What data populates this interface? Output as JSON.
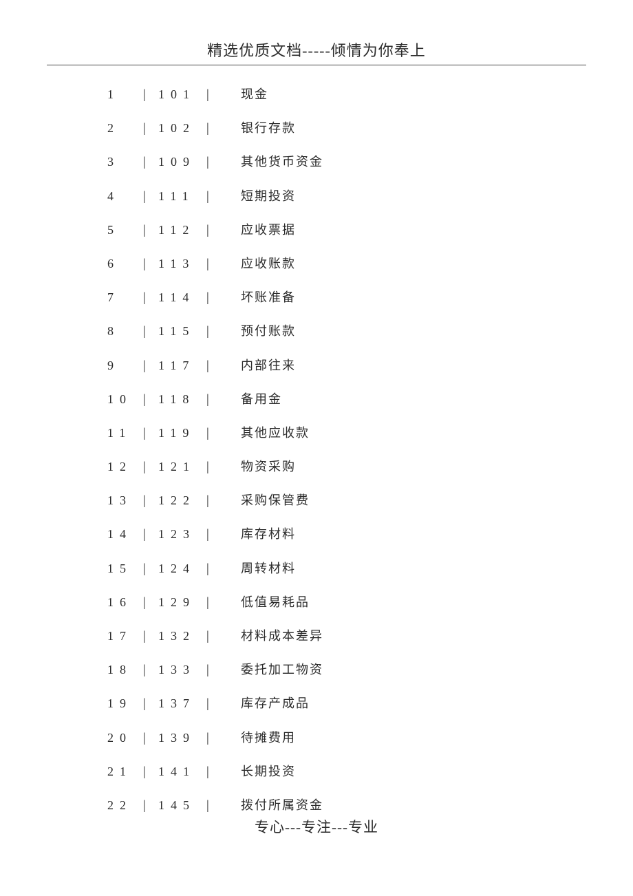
{
  "header": "精选优质文档-----倾情为你奉上",
  "footer": "专心---专注---专业",
  "sep": "|",
  "rows": [
    {
      "seq": "1",
      "code": "101",
      "name": "现金"
    },
    {
      "seq": "2",
      "code": "102",
      "name": "银行存款"
    },
    {
      "seq": "3",
      "code": "109",
      "name": "其他货币资金"
    },
    {
      "seq": "4",
      "code": "111",
      "name": "短期投资"
    },
    {
      "seq": "5",
      "code": "112",
      "name": "应收票据"
    },
    {
      "seq": "6",
      "code": "113",
      "name": "应收账款"
    },
    {
      "seq": "7",
      "code": "114",
      "name": "坏账准备"
    },
    {
      "seq": "8",
      "code": "115",
      "name": "预付账款"
    },
    {
      "seq": "9",
      "code": "117",
      "name": "内部往来"
    },
    {
      "seq": "10",
      "code": "118",
      "name": "备用金"
    },
    {
      "seq": "11",
      "code": "119",
      "name": "其他应收款"
    },
    {
      "seq": "12",
      "code": "121",
      "name": "物资采购"
    },
    {
      "seq": "13",
      "code": "122",
      "name": "采购保管费"
    },
    {
      "seq": "14",
      "code": "123",
      "name": "库存材料"
    },
    {
      "seq": "15",
      "code": "124",
      "name": "周转材料"
    },
    {
      "seq": "16",
      "code": "129",
      "name": "低值易耗品"
    },
    {
      "seq": "17",
      "code": "132",
      "name": "材料成本差异"
    },
    {
      "seq": "18",
      "code": "133",
      "name": "委托加工物资"
    },
    {
      "seq": "19",
      "code": "137",
      "name": "库存产成品"
    },
    {
      "seq": "20",
      "code": "139",
      "name": "待摊费用"
    },
    {
      "seq": "21",
      "code": "141",
      "name": "长期投资"
    },
    {
      "seq": "22",
      "code": "145",
      "name": "拨付所属资金"
    }
  ]
}
